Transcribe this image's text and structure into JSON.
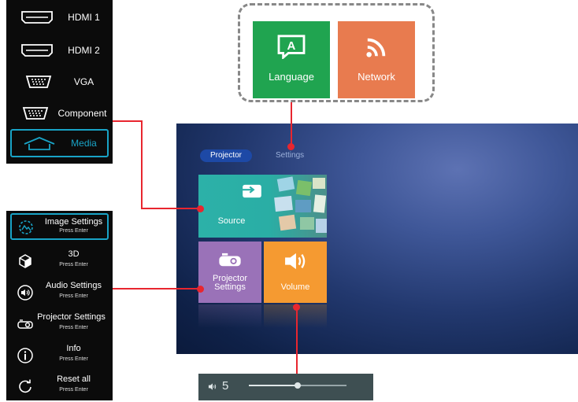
{
  "source_menu": {
    "items": [
      {
        "label": "HDMI 1",
        "icon": "hdmi-icon"
      },
      {
        "label": "HDMI 2",
        "icon": "hdmi-icon"
      },
      {
        "label": "VGA",
        "icon": "vga-icon"
      },
      {
        "label": "Component",
        "icon": "component-icon"
      },
      {
        "label": "Media",
        "icon": "media-icon",
        "selected": true
      }
    ]
  },
  "settings_menu": {
    "items": [
      {
        "title": "Image Settings",
        "subtitle": "Press Enter",
        "icon": "image-settings-icon",
        "selected": true
      },
      {
        "title": "3D",
        "subtitle": "Press Enter",
        "icon": "3d-cube-icon"
      },
      {
        "title": "Audio Settings",
        "subtitle": "Press Enter",
        "icon": "speaker-icon"
      },
      {
        "title": "Projector Settings",
        "subtitle": "Press Enter",
        "icon": "projector-icon"
      },
      {
        "title": "Info",
        "subtitle": "Press Enter",
        "icon": "info-icon"
      },
      {
        "title": "Reset all",
        "subtitle": "Press Enter",
        "icon": "reset-icon"
      }
    ]
  },
  "settings_tiles": {
    "language": "Language",
    "network": "Network"
  },
  "home": {
    "tabs": {
      "projector": "Projector",
      "settings": "Settings"
    },
    "tiles": {
      "source": "Source",
      "projector_settings_line1": "Projector",
      "projector_settings_line2": "Settings",
      "volume": "Volume"
    }
  },
  "volume_bar": {
    "level_text": "5",
    "level_fraction": 0.5
  },
  "colors": {
    "accent": "#19a3c6",
    "connector": "#e8262f",
    "language_tile": "#20a450",
    "network_tile": "#e87b4f",
    "source_tile": "#2cb1a8",
    "projector_tile": "#9a72b8",
    "volume_tile": "#f59a31"
  }
}
